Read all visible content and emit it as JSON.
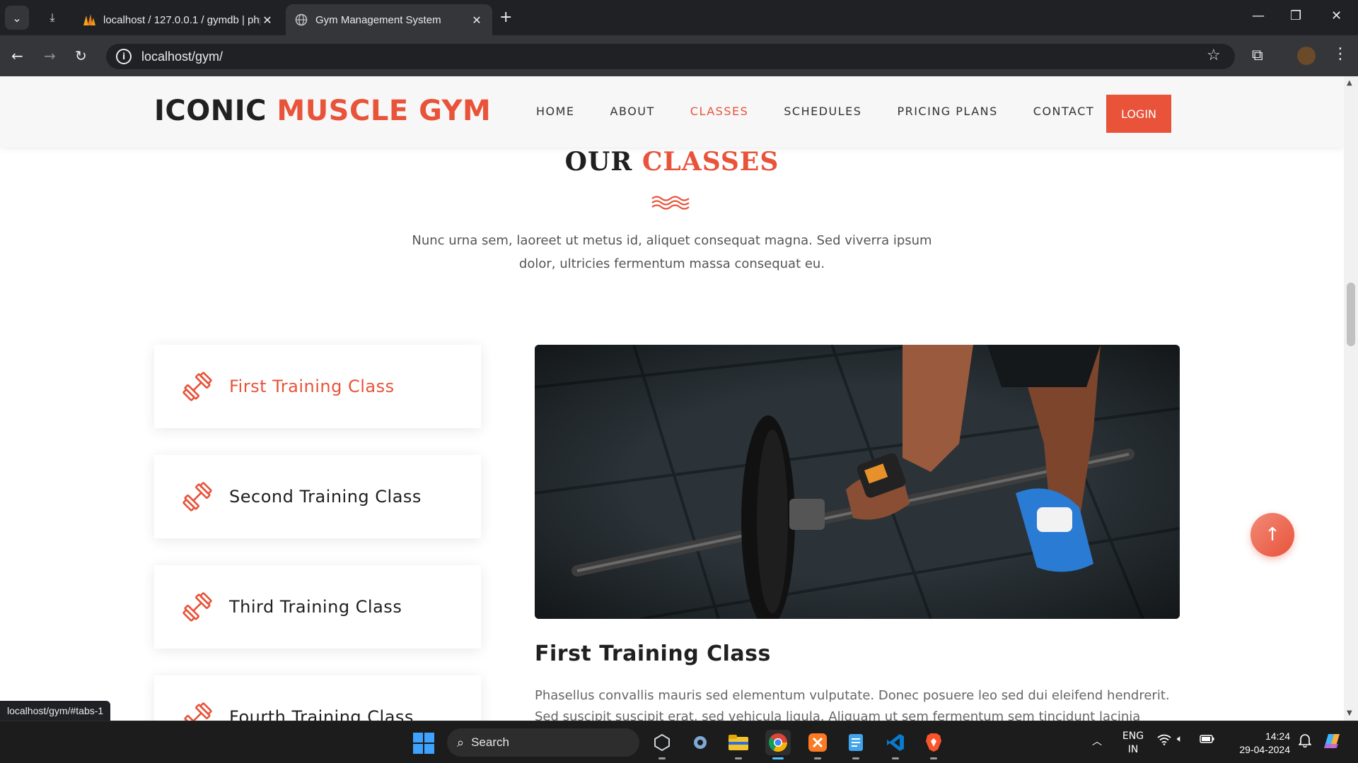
{
  "browser": {
    "tabs": [
      {
        "title": "localhost / 127.0.0.1 / gymdb | php",
        "icon": "phpmyadmin-icon"
      },
      {
        "title": "Gym Management System",
        "icon": "globe-icon",
        "active": true
      }
    ],
    "url": "localhost/gym/",
    "status_url": "localhost/gym/#tabs-1"
  },
  "site": {
    "logo_part1": "ICONIC ",
    "logo_part2": "MUSCLE GYM",
    "nav": [
      {
        "label": "HOME",
        "active": false
      },
      {
        "label": "ABOUT",
        "active": false
      },
      {
        "label": "CLASSES",
        "active": true
      },
      {
        "label": "SCHEDULES",
        "active": false
      },
      {
        "label": "PRICING PLANS",
        "active": false
      },
      {
        "label": "CONTACT",
        "active": false
      }
    ],
    "login_label": "LOGIN"
  },
  "classes_section": {
    "title_part1": "OUR ",
    "title_part2": "CLASSES",
    "description": "Nunc urna sem, laoreet ut metus id, aliquet consequat magna. Sed viverra ipsum dolor, ultricies fermentum massa consequat eu.",
    "tabs": [
      {
        "label": "First Training Class",
        "active": true
      },
      {
        "label": "Second Training Class",
        "active": false
      },
      {
        "label": "Third Training Class",
        "active": false
      },
      {
        "label": "Fourth Training Class",
        "active": false
      }
    ],
    "detail_title": "First Training Class",
    "detail_text": "Phasellus convallis mauris sed elementum vulputate. Donec posuere leo sed dui eleifend hendrerit. Sed suscipit suscipit erat, sed vehicula ligula. Aliquam ut sem fermentum sem tincidunt lacinia gravida aliquam nunc. Morbi"
  },
  "colors": {
    "accent": "#e8533a",
    "dark": "#202020"
  },
  "taskbar": {
    "search_label": "Search",
    "lang_line1": "ENG",
    "lang_line2": "IN",
    "time": "14:24",
    "date": "29-04-2024"
  }
}
